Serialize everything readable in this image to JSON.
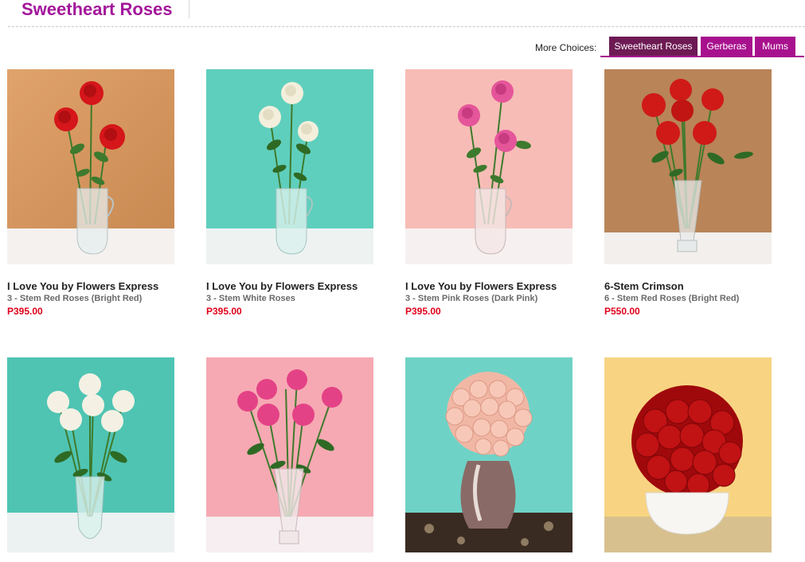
{
  "page": {
    "title": "Sweetheart Roses",
    "accent_color": "#a3169b",
    "price_color": "#e0001b"
  },
  "choices": {
    "label": "More Choices:",
    "tabs": [
      {
        "label": "Sweetheart Roses",
        "active": true
      },
      {
        "label": "Gerberas",
        "active": false
      },
      {
        "label": "Mums",
        "active": false
      }
    ]
  },
  "products": [
    {
      "name": "I Love You by Flowers Express",
      "description": "3 - Stem Red Roses (Bright Red)",
      "price": "P395.00",
      "image": "red-roses-in-glass-jug"
    },
    {
      "name": "I Love You by Flowers Express",
      "description": "3 - Stem White Roses",
      "price": "P395.00",
      "image": "white-roses-in-glass-jug"
    },
    {
      "name": "I Love You by Flowers Express",
      "description": "3 - Stem Pink Roses (Dark Pink)",
      "price": "P395.00",
      "image": "pink-roses-in-glass-jug"
    },
    {
      "name": "6-Stem Crimson",
      "description": "6 - Stem Red Roses (Bright Red)",
      "price": "P550.00",
      "image": "red-roses-in-tall-vase"
    },
    {
      "name": "",
      "description": "",
      "price": "",
      "image": "white-roses-in-cut-glass-vase"
    },
    {
      "name": "",
      "description": "",
      "price": "",
      "image": "pink-roses-in-fluted-vase"
    },
    {
      "name": "",
      "description": "",
      "price": "",
      "image": "peach-roses-in-chrome-vase"
    },
    {
      "name": "",
      "description": "",
      "price": "",
      "image": "red-roses-in-white-bowl"
    }
  ]
}
